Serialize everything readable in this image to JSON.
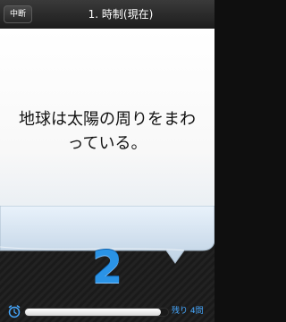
{
  "navbar": {
    "back_label": "中断",
    "title": "1. 時制(現在)"
  },
  "question": {
    "text": "地球は太陽の周りをまわっている。"
  },
  "answer": {
    "digit": "2"
  },
  "status": {
    "remaining_label": "残り 4問",
    "timer_progress": 0.95
  },
  "colors": {
    "accent_blue": "#2a93e6",
    "remaining_blue": "#46a8ff"
  },
  "icons": {
    "timer": "alarm-clock-icon",
    "back": "back-chevron-button"
  }
}
